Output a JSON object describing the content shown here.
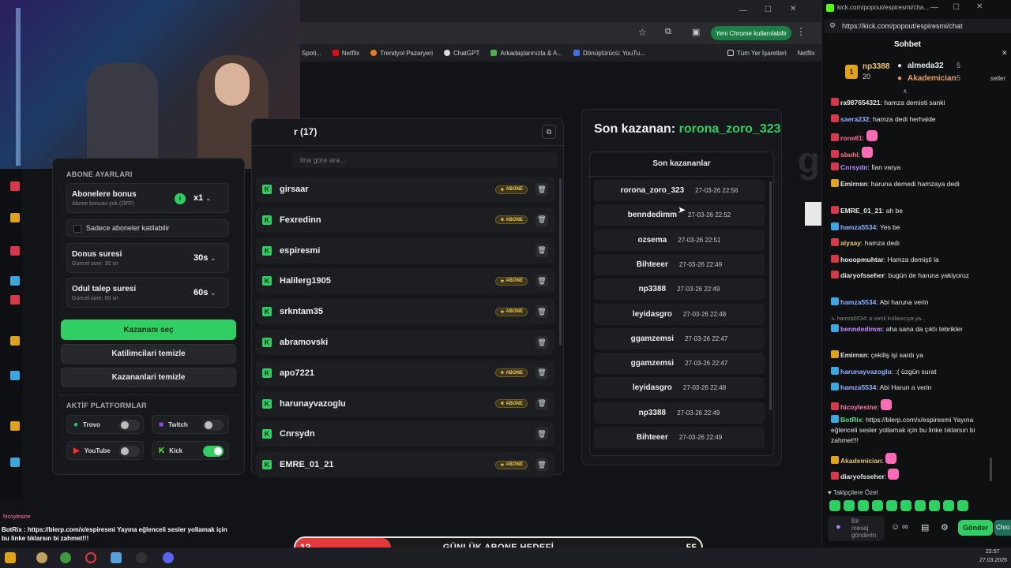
{
  "browser": {
    "chrome_button": "Yeni Chrome kullanılabilir",
    "bookmarks": [
      "Spoti...",
      "Netflix",
      "Trendyol Pazaryeri",
      "ChatGPT",
      "Arkadaşlarınızla & A...",
      "Dönüştürücü: YouTu...",
      "Tüm Yer İşaretleri",
      "Netflix"
    ]
  },
  "giveaway": {
    "participants_title": "r (17)",
    "search_placeholder": "lina gore ara...",
    "sub_settings_title": "ABONE AYARLARI",
    "bonus_title": "Abonelere bonus",
    "bonus_sub": "Abone bonusu yok (OFF)",
    "bonus_value": "x1",
    "subs_only": "Sadece aboneler katilabilir",
    "duration_title": "Donus suresi",
    "duration_sub": "Guncel sure: 30 sn",
    "duration_value": "30s",
    "claim_title": "Odul talep suresi",
    "claim_sub": "Guncel sure: 60 sn",
    "claim_value": "60s",
    "pick_winner": "Kazananı seç",
    "clear_participants": "Katilimcilari temizle",
    "clear_winners": "Kazananlari temizle",
    "platforms_title": "AKTİF PLATFORMLAR",
    "platforms": [
      "Trovo",
      "Twitch",
      "YouTube",
      "Kick"
    ],
    "sub_badge": "ABONE",
    "participants": [
      {
        "name": "girsaar",
        "sub": true
      },
      {
        "name": "Fexredinn",
        "sub": true
      },
      {
        "name": "espiresmi",
        "sub": false
      },
      {
        "name": "Halilerg1905",
        "sub": true
      },
      {
        "name": "srkntam35",
        "sub": true
      },
      {
        "name": "abramovski",
        "sub": false
      },
      {
        "name": "apo7221",
        "sub": true
      },
      {
        "name": "harunayvazoglu",
        "sub": true
      },
      {
        "name": "Cnrsydn",
        "sub": false
      },
      {
        "name": "EMRE_01_21",
        "sub": true
      }
    ],
    "last_winner_label": "Son kazanan:",
    "last_winner_name": "rorona_zoro_323",
    "winners_title": "Son kazananlar",
    "winners": [
      {
        "name": "rorona_zoro_323",
        "time": "27-03-26 22:56"
      },
      {
        "name": "benndedimm",
        "time": "27-03-26 22:52"
      },
      {
        "name": "ozsema",
        "time": "27-03-26 22:51"
      },
      {
        "name": "Bihteeer",
        "time": "27-03-26 22:49"
      },
      {
        "name": "np3388",
        "time": "27-03-26 22:49"
      },
      {
        "name": "leyidasgro",
        "time": "27-03-26 22:48"
      },
      {
        "name": "ggamzemsi",
        "time": "27-03-26 22:47"
      },
      {
        "name": "ggamzemsi",
        "time": "27-03-26 22:47"
      },
      {
        "name": "leyidasgro",
        "time": "27-03-26 22:48"
      },
      {
        "name": "np3388",
        "time": "27-03-26 22:49"
      },
      {
        "name": "Bihteeer",
        "time": "27-03-26 22:49"
      }
    ]
  },
  "chat": {
    "window_title": "kick.com/popout/espiresmi/cha...",
    "url": "https://kick.com/popout/espiresmi/chat",
    "title": "Sohbet",
    "top_gifters": [
      {
        "name": "np3388",
        "count": "20"
      },
      {
        "name": "almeda32",
        "count": "5"
      },
      {
        "name": "Akademician",
        "count": "5"
      }
    ],
    "messages": [
      {
        "user": "ra987654321",
        "color": "#e8e8e8",
        "text": "hamza demisti sanki"
      },
      {
        "user": "saera232",
        "color": "#8fb3ff",
        "text": "hamza dedi herhalde"
      },
      {
        "user": "rone81",
        "color": "#ff6b9a",
        "text": ""
      },
      {
        "user": "sbuhi",
        "color": "#ff7a7a",
        "text": ""
      },
      {
        "user": "Cnrsydn",
        "color": "#b48cff",
        "text": "İlan varya"
      },
      {
        "user": "Emirnsn",
        "color": "#e8e8e8",
        "text": "haruna demedi hamzaya dedi"
      },
      {
        "user": "EMRE_01_21",
        "color": "#e8e8e8",
        "text": "ah be"
      },
      {
        "user": "hamza5534",
        "color": "#8fb3ff",
        "text": "Yes be"
      },
      {
        "user": "alyaay",
        "color": "#e8c36a",
        "text": "hamza dedı"
      },
      {
        "user": "hooopmuhtar",
        "color": "#e8e8e8",
        "text": "Hamza demişti la"
      },
      {
        "user": "diaryofsseher",
        "color": "#e8e8e8",
        "text": "bugün de haruna yakiyoruz"
      },
      {
        "user": "hamza5534",
        "color": "#8fb3ff",
        "text": "Abi haruna verin"
      },
      {
        "user": "benndedimm",
        "color": "#c98cff",
        "text": "aha sana da çıktı tebrikler"
      },
      {
        "user": "Emirnsn",
        "color": "#e8e8e8",
        "text": "çekiliş işi sardı ya"
      },
      {
        "user": "harunayvazoglu",
        "color": "#8fb3ff",
        "text": ":( üzgün surat"
      },
      {
        "user": "hamza5534",
        "color": "#8fb3ff",
        "text": "Abi Harun a verin"
      },
      {
        "user": "hicoylesine",
        "color": "#ff7ab0",
        "text": ""
      },
      {
        "user": "BotRix",
        "color": "#5ee08a",
        "text": "https://blerp.com/x/espiresmi Yayına eğlenceli sesler yollamak için bu linke tıklarsın bi zahmet!!!"
      },
      {
        "user": "Akademician",
        "color": "#e8c36a",
        "text": ""
      },
      {
        "user": "diaryofsseher",
        "color": "#e8e8e8",
        "text": ""
      }
    ],
    "reply_snippet": "hamza5534:",
    "reply_rest": "a isimli kullanıcıya ya...",
    "followers_only": "Takipçilere Özel",
    "input_placeholder": "Bir mesaj gönderin",
    "send": "Gönder",
    "side_text": "seller",
    "side_btn": "Chro"
  },
  "stream_overlay": {
    "botrix_line": "BotRix : https://blerp.com/x/espiresmi Yayına eğlenceli sesler yollamak için bu linke tıklarsın bi zahmet!!!",
    "hico": "hicoylesine",
    "goal_label": "GÜNLÜK ABONE HEDEFİ",
    "goal_current": "13",
    "goal_target": "55",
    "goal_progress": 0.236
  },
  "taskbar": {
    "time": "22:57",
    "date": "27.03.2026"
  },
  "colors": {
    "accent": "#2fcf64",
    "kick": "#53fc18"
  }
}
